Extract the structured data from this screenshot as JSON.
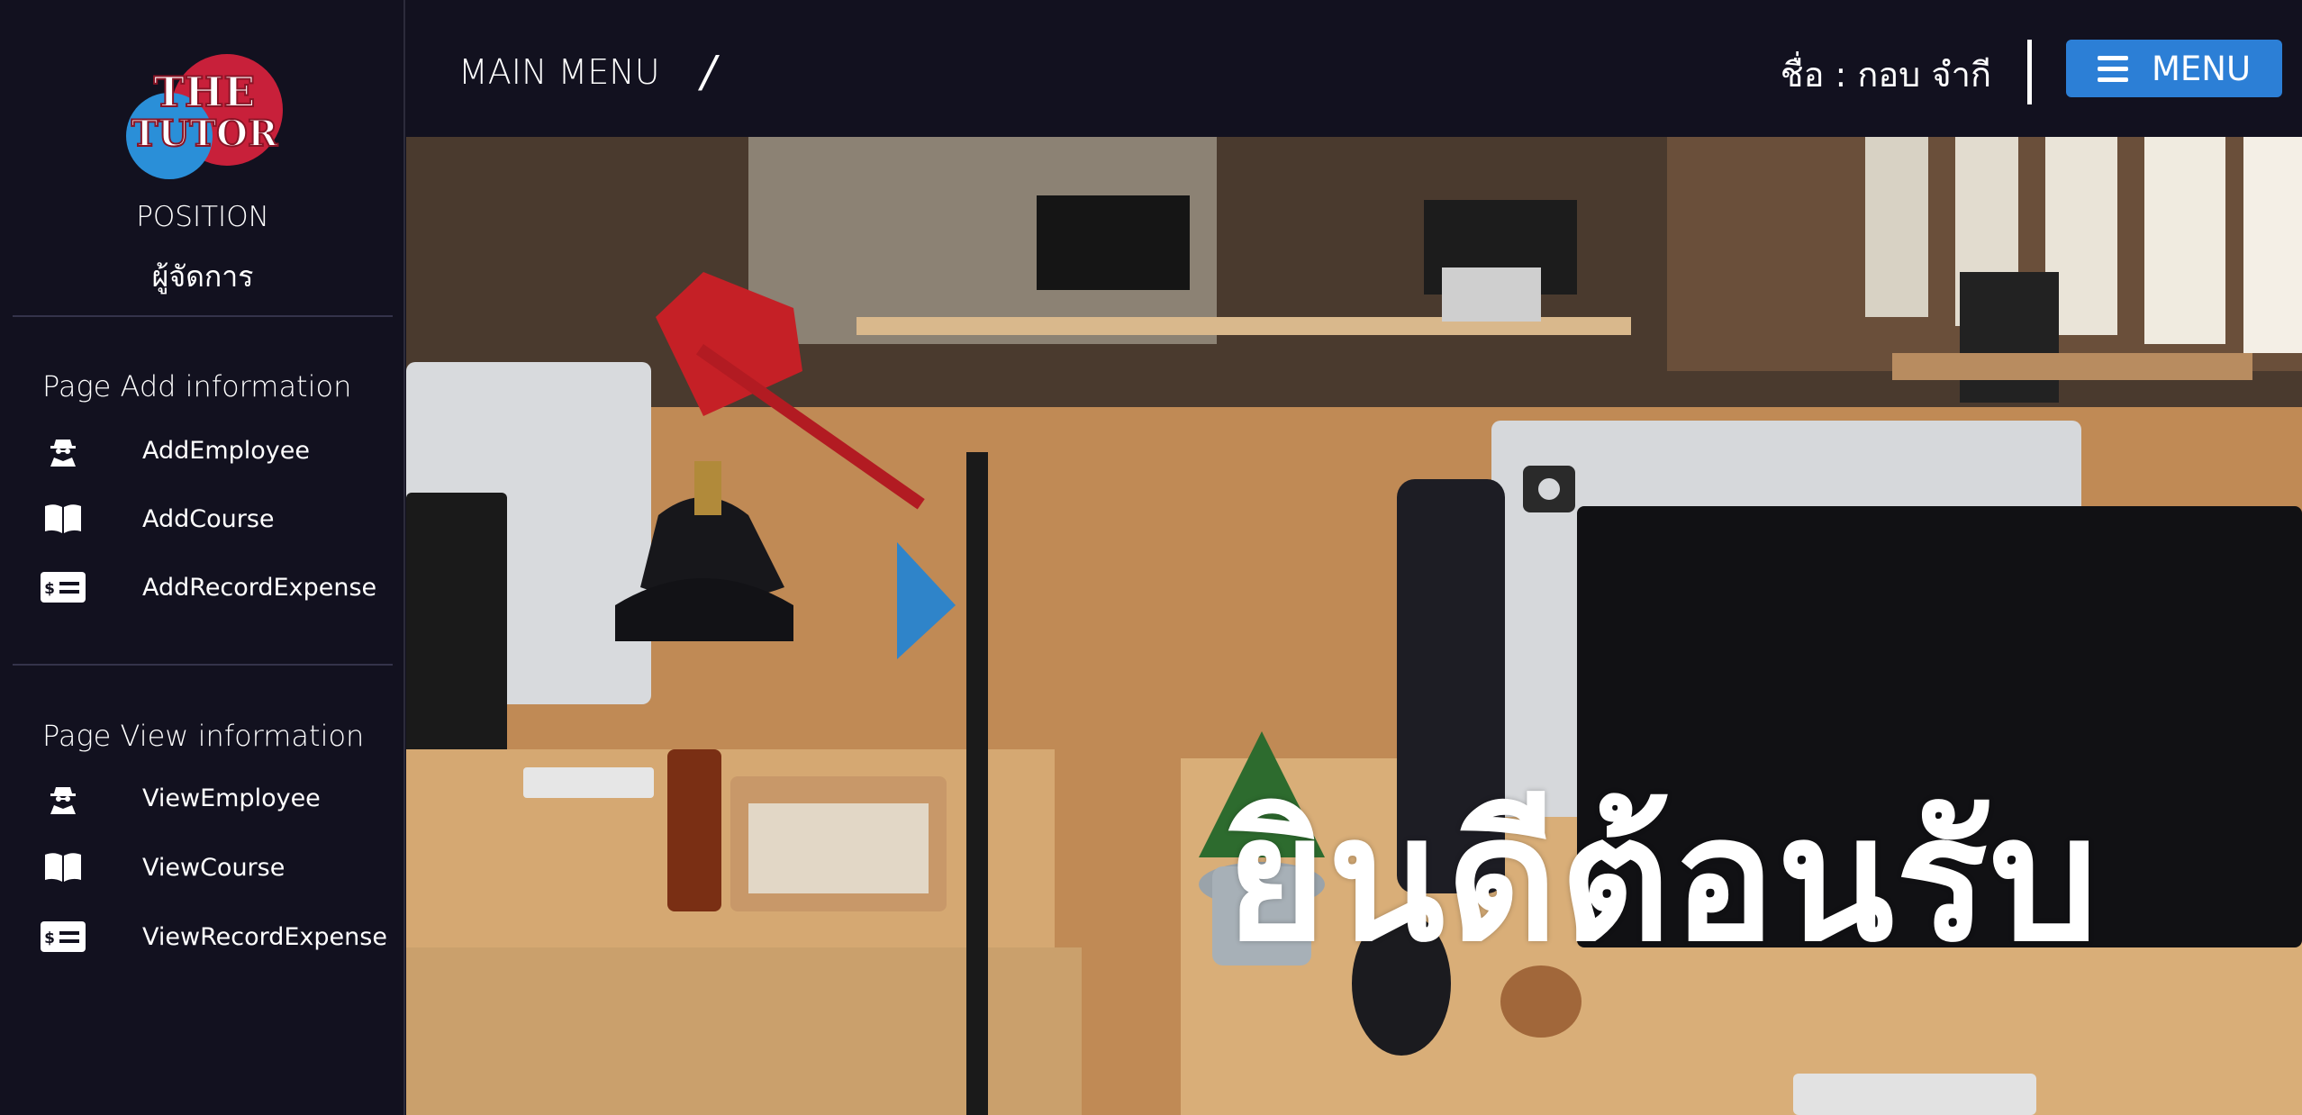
{
  "sidebar": {
    "logo_text_line1": "THE",
    "logo_text_line2": "TUTOR",
    "position_label": "POSITION",
    "position_value": "ผู้จัดการ",
    "sections": [
      {
        "title": "Page Add information",
        "items": [
          {
            "label": "AddEmployee",
            "icon": "user-secret-icon"
          },
          {
            "label": "AddCourse",
            "icon": "book-icon"
          },
          {
            "label": "AddRecordExpense",
            "icon": "money-check-icon"
          }
        ]
      },
      {
        "title": "Page View information",
        "items": [
          {
            "label": "ViewEmployee",
            "icon": "user-secret-icon"
          },
          {
            "label": "ViewCourse",
            "icon": "book-icon"
          },
          {
            "label": "ViewRecordExpense",
            "icon": "money-check-icon"
          }
        ]
      }
    ]
  },
  "topbar": {
    "breadcrumb": "MAIN MENU",
    "separator": "/",
    "user_name": "ชื่อ : กอบ จำกี",
    "menu_button": "MENU"
  },
  "hero": {
    "welcome_text": "ยินดีต้อนรับ"
  },
  "colors": {
    "background": "#12111f",
    "accent": "#2c7fd6",
    "logo_red": "#c8203a",
    "logo_blue": "#2a8fd8"
  }
}
